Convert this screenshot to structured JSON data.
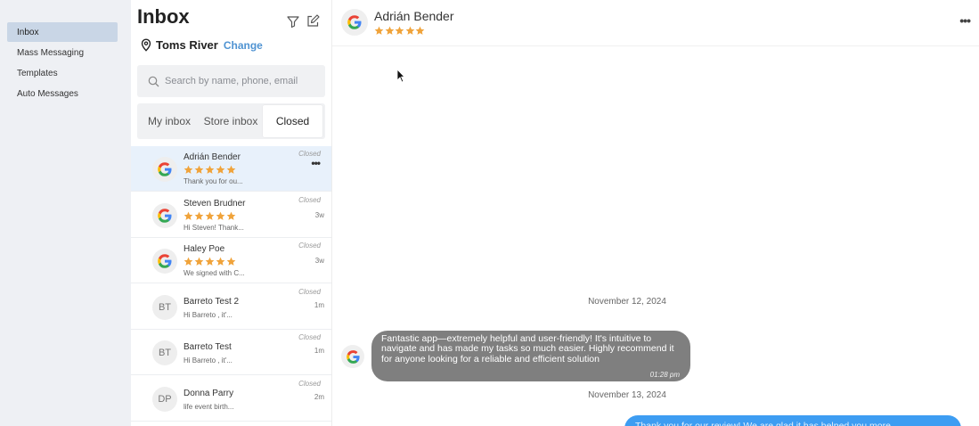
{
  "nav": {
    "items": [
      {
        "label": "Inbox",
        "active": true
      },
      {
        "label": "Mass Messaging",
        "active": false
      },
      {
        "label": "Templates",
        "active": false
      },
      {
        "label": "Auto Messages",
        "active": false
      }
    ]
  },
  "inbox": {
    "title": "Inbox",
    "location": "Toms River",
    "change_label": "Change",
    "search_placeholder": "Search by name, phone, email",
    "tabs": [
      {
        "label": "My inbox",
        "active": false
      },
      {
        "label": "Store inbox",
        "active": false
      },
      {
        "label": "Closed",
        "active": true
      }
    ],
    "conversations": [
      {
        "name": "Adrián Bender",
        "preview": "Thank you for ou...",
        "status": "Closed",
        "time": "",
        "rating": 5,
        "source": "google",
        "initials": "",
        "active": true
      },
      {
        "name": "Steven Brudner",
        "preview": "Hi Steven! Thank...",
        "status": "Closed",
        "time": "3w",
        "rating": 5,
        "source": "google",
        "initials": "",
        "active": false
      },
      {
        "name": "Haley Poe",
        "preview": "We signed with C...",
        "status": "Closed",
        "time": "3w",
        "rating": 5,
        "source": "google",
        "initials": "",
        "active": false
      },
      {
        "name": "Barreto Test 2",
        "preview": "Hi Barreto , it'...",
        "status": "Closed",
        "time": "1m",
        "rating": 0,
        "source": "sms",
        "initials": "BT",
        "active": false
      },
      {
        "name": "Barreto Test",
        "preview": "Hi Barreto , it'...",
        "status": "Closed",
        "time": "1m",
        "rating": 0,
        "source": "sms",
        "initials": "BT",
        "active": false
      },
      {
        "name": "Donna Parry",
        "preview": "life event birth...",
        "status": "Closed",
        "time": "2m",
        "rating": 0,
        "source": "sms",
        "initials": "DP",
        "active": false
      }
    ]
  },
  "chat": {
    "contact_name": "Adrián Bender",
    "rating": 5,
    "date_1": "November 12, 2024",
    "incoming_message": "Fantastic app—extremely helpful and user-friendly! It's intuitive to navigate and has made my tasks so much easier. Highly recommend it for anyone looking for a reliable and efficient solution",
    "incoming_time": "01:28 pm",
    "date_2": "November 13, 2024",
    "outgoing_message_partial": "Thank you for our review! We are glad it has helped you more..."
  },
  "colors": {
    "star": "#f0a33a",
    "accent": "#4f93d2",
    "bubble_in": "#7f7f7f",
    "bubble_out": "#3d9df2",
    "nav_active": "#c9d6e6",
    "row_active": "#e8f1fb"
  },
  "icons": [
    "filter-icon",
    "compose-icon",
    "location-pin-icon",
    "search-icon",
    "google-icon",
    "more-icon",
    "star-icon",
    "cursor-icon"
  ]
}
